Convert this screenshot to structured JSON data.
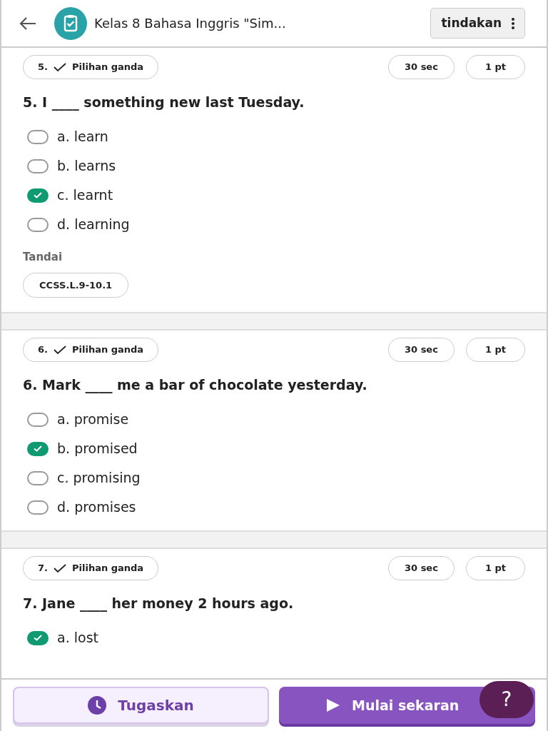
{
  "header": {
    "title": "Kelas 8 Bahasa Inggris \"Sim...",
    "action": "tindakan"
  },
  "questions": [
    {
      "number": "5.",
      "type": "Pilihan ganda",
      "time": "30 sec",
      "points": "1 pt",
      "text": "5. I ____ something new last Tuesday.",
      "options": [
        {
          "label": "a. learn",
          "correct": false
        },
        {
          "label": "b. learns",
          "correct": false
        },
        {
          "label": "c. learnt",
          "correct": true
        },
        {
          "label": "d. learning",
          "correct": false
        }
      ],
      "tags_label": "Tandai",
      "tags": [
        "CCSS.L.9-10.1"
      ]
    },
    {
      "number": "6.",
      "type": "Pilihan ganda",
      "time": "30 sec",
      "points": "1 pt",
      "text": "6. Mark ____ me a bar of chocolate yesterday.",
      "options": [
        {
          "label": "a. promise",
          "correct": false
        },
        {
          "label": "b. promised",
          "correct": true
        },
        {
          "label": "c. promising",
          "correct": false
        },
        {
          "label": "d. promises",
          "correct": false
        }
      ]
    },
    {
      "number": "7.",
      "type": "Pilihan ganda",
      "time": "30 sec",
      "points": "1 pt",
      "text": "7. Jane ____ her money 2 hours ago.",
      "options": [
        {
          "label": "a. lost",
          "correct": true
        }
      ]
    }
  ],
  "footer": {
    "assign": "Tugaskan",
    "start": "Mulai sekaran",
    "help": "?"
  }
}
